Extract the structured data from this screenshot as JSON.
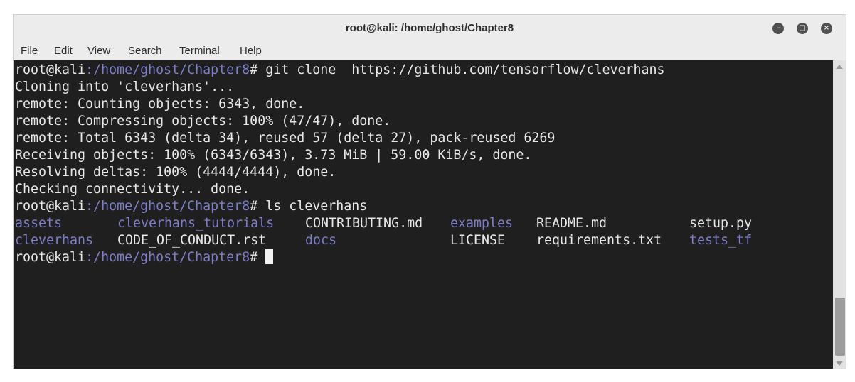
{
  "window": {
    "title": "root@kali: /home/ghost/Chapter8",
    "buttons": {
      "minimize_icon": "–",
      "maximize_icon": "□",
      "close_icon": "×"
    }
  },
  "menu": [
    "File",
    "Edit",
    "View",
    "Search",
    "Terminal",
    "Help"
  ],
  "terminal": {
    "prompt_user": "root@kali",
    "prompt_path": ":/home/ghost/Chapter8",
    "prompt_suffix": "# ",
    "commands": [
      "git clone  https://github.com/tensorflow/cleverhans",
      "ls cleverhans"
    ],
    "output": [
      "Cloning into 'cleverhans'...",
      "remote: Counting objects: 6343, done.",
      "remote: Compressing objects: 100% (47/47), done.",
      "remote: Total 6343 (delta 34), reused 57 (delta 27), pack-reused 6269",
      "Receiving objects: 100% (6343/6343), 3.73 MiB | 59.00 KiB/s, done.",
      "Resolving deltas: 100% (4444/4444), done.",
      "Checking connectivity... done."
    ],
    "listing": [
      [
        {
          "name": "assets",
          "type": "dir"
        },
        {
          "name": "cleverhans_tutorials",
          "type": "dir"
        },
        {
          "name": "CONTRIBUTING.md",
          "type": "file"
        },
        {
          "name": "examples",
          "type": "dir"
        },
        {
          "name": "README.md",
          "type": "file"
        },
        {
          "name": "setup.py",
          "type": "file"
        }
      ],
      [
        {
          "name": "cleverhans",
          "type": "dir"
        },
        {
          "name": "CODE_OF_CONDUCT.rst",
          "type": "file"
        },
        {
          "name": "docs",
          "type": "dir"
        },
        {
          "name": "LICENSE",
          "type": "file"
        },
        {
          "name": "requirements.txt",
          "type": "file"
        },
        {
          "name": "tests_tf",
          "type": "dir"
        }
      ]
    ]
  },
  "colors": {
    "terminal_bg": "#1f1f1f",
    "terminal_fg": "#e8e8e8",
    "path": "#7e7ec8",
    "directory": "#7e7ec8"
  }
}
